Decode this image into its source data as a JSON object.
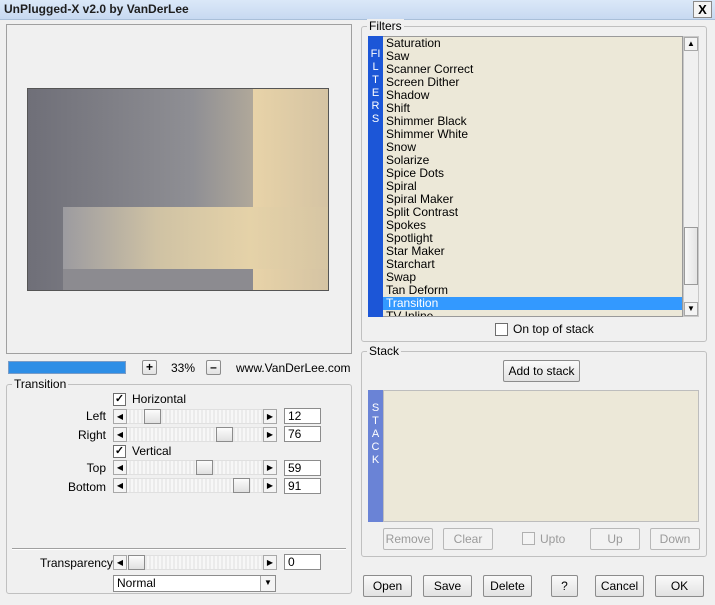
{
  "window": {
    "title": "UnPlugged-X v2.0 by VanDerLee",
    "close_label": "X"
  },
  "preview": {
    "progress": 1.0,
    "zoom_plus": "+",
    "zoom_minus": "–",
    "zoom_value": "33%",
    "website": "www.VanDerLee.com"
  },
  "transition": {
    "group_label": "Transition",
    "horizontal": {
      "label": "Horizontal",
      "checked": true,
      "check_mark": "✓"
    },
    "left": {
      "label": "Left",
      "value": "12"
    },
    "right": {
      "label": "Right",
      "value": "76"
    },
    "vertical": {
      "label": "Vertical",
      "checked": true,
      "check_mark": "✓"
    },
    "top": {
      "label": "Top",
      "value": "59"
    },
    "bottom": {
      "label": "Bottom",
      "value": "91"
    }
  },
  "transparency": {
    "label": "Transparency",
    "value": "0",
    "blend_mode": "Normal"
  },
  "filters": {
    "group_label": "Filters",
    "band_text": "FILTERS",
    "items": [
      "Saturation",
      "Saw",
      "Scanner Correct",
      "Screen Dither",
      "Shadow",
      "Shift",
      "Shimmer Black",
      "Shimmer White",
      "Snow",
      "Solarize",
      "Spice Dots",
      "Spiral",
      "Spiral Maker",
      "Split Contrast",
      "Spokes",
      "Spotlight",
      "Star Maker",
      "Starchart",
      "Swap",
      "Tan Deform",
      "Transition",
      "TV Inline"
    ],
    "selected": "Transition",
    "on_top_label": "On top of stack"
  },
  "stack": {
    "group_label": "Stack",
    "band_text": "STACK",
    "add_label": "Add to stack",
    "remove_label": "Remove",
    "clear_label": "Clear",
    "upto_label": "Upto",
    "up_label": "Up",
    "down_label": "Down"
  },
  "buttons": {
    "open": "Open",
    "save": "Save",
    "delete": "Delete",
    "help": "?",
    "cancel": "Cancel",
    "ok": "OK"
  },
  "icons": {
    "left_arrow": "◀",
    "right_arrow": "▶",
    "up_arrow": "▲",
    "down_arrow": "▼"
  },
  "colors": {
    "filters_band": "#1c56d7",
    "stack_band": "#6a83d6",
    "selection": "#3399ff",
    "progress": "#2e8ee6"
  }
}
